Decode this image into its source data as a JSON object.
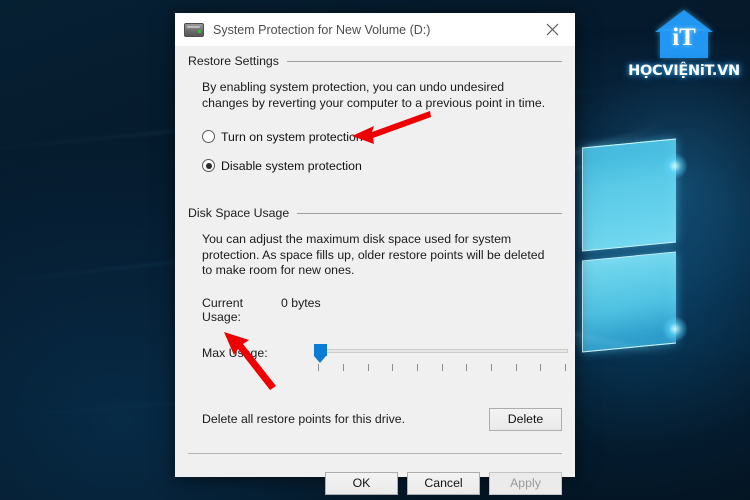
{
  "window": {
    "title": "System Protection for New Volume (D:)",
    "icon": "hard-drive-icon",
    "close_label": "✕"
  },
  "restore_settings": {
    "group_title": "Restore Settings",
    "description": "By enabling system protection, you can undo undesired changes by reverting your computer to a previous point in time.",
    "options": [
      {
        "label": "Turn on system protection",
        "selected": false
      },
      {
        "label": "Disable system protection",
        "selected": true
      }
    ]
  },
  "disk_space_usage": {
    "group_title": "Disk Space Usage",
    "description": "You can adjust the maximum disk space used for system protection. As space fills up, older restore points will be deleted to make room for new ones.",
    "current_usage_label": "Current Usage:",
    "current_usage_value": "0 bytes",
    "max_usage_label": "Max Usage:",
    "slider": {
      "value_percent": 1,
      "min": 0,
      "max": 100,
      "tick_count": 11
    }
  },
  "delete_section": {
    "text": "Delete all restore points for this drive.",
    "button_label": "Delete"
  },
  "footer": {
    "ok_label": "OK",
    "cancel_label": "Cancel",
    "apply_label": "Apply",
    "apply_disabled": true
  },
  "watermark": {
    "icon_text": "iT",
    "brand_text": "HỌCVIỆNiT.VN"
  },
  "colors": {
    "accent_blue": "#0b7bd4",
    "dialog_bg": "#f0f0f0",
    "titlebar_bg": "#ffffff",
    "annotation_red": "#ee0000",
    "desktop_navy": "#06182b"
  }
}
